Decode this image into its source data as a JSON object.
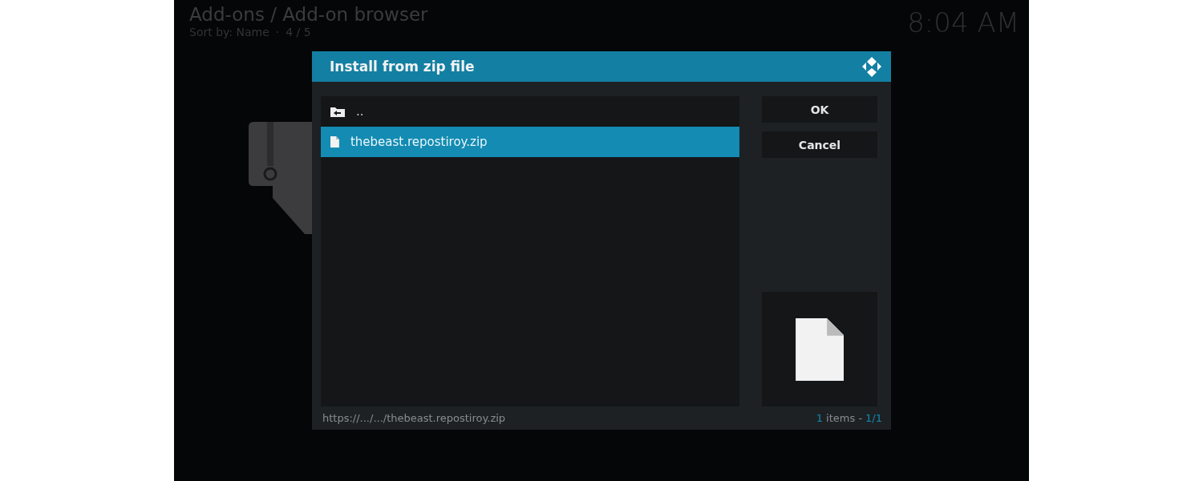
{
  "header": {
    "breadcrumb": "Add-ons / Add-on browser",
    "sort": "Sort by: Name",
    "separator": "·",
    "position": "4 / 5",
    "clock": "8:04 AM"
  },
  "dialog": {
    "title": "Install from zip file",
    "items": [
      {
        "kind": "parent",
        "label": "..",
        "selected": false
      },
      {
        "kind": "file",
        "label": "thebeast.repostiroy.zip",
        "selected": true
      }
    ],
    "buttons": [
      "OK",
      "Cancel"
    ],
    "path": "https://.../.../thebeast.repostiroy.zip",
    "count": "1",
    "count_label": "items -",
    "pages": "1/1"
  }
}
